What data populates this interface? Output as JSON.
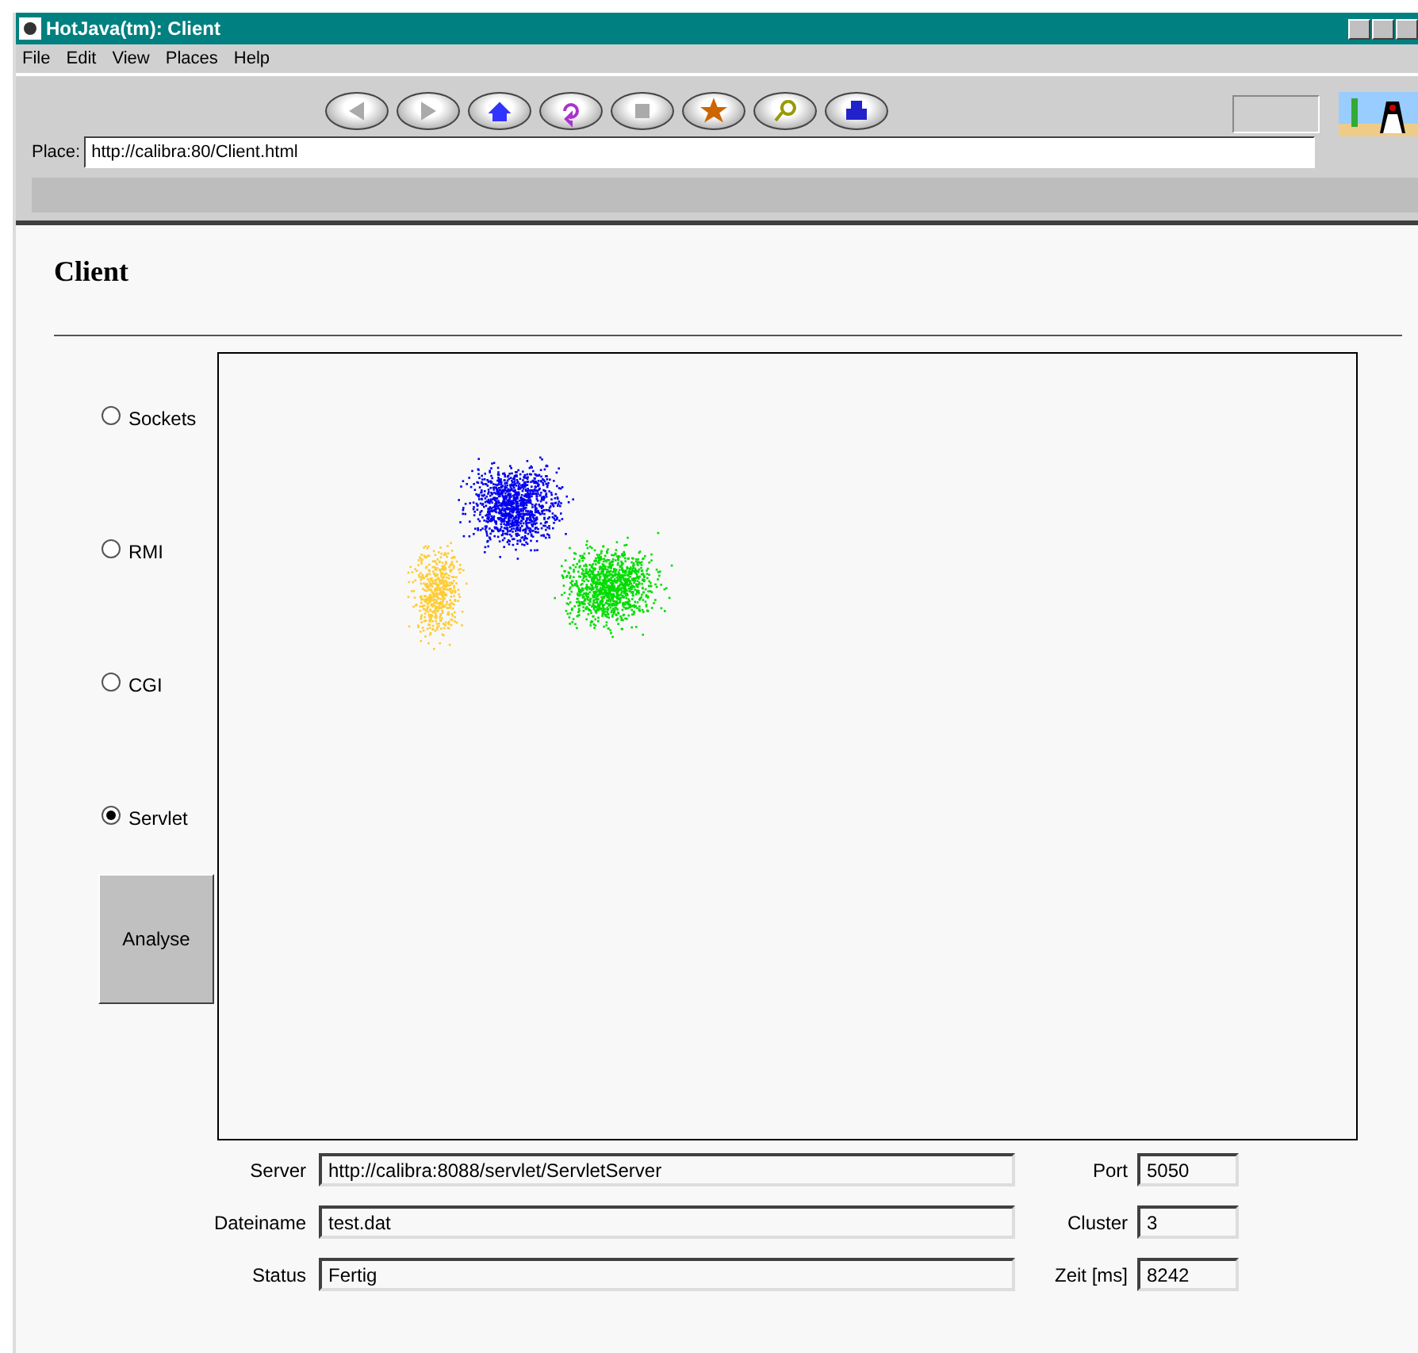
{
  "window": {
    "title": "HotJava(tm): Client"
  },
  "menu": [
    "File",
    "Edit",
    "View",
    "Places",
    "Help"
  ],
  "toolbar": {
    "buttons": [
      {
        "kind": "back",
        "disabled": true
      },
      {
        "kind": "forward",
        "disabled": true
      },
      {
        "kind": "home",
        "disabled": false
      },
      {
        "kind": "reload",
        "disabled": false
      },
      {
        "kind": "stop",
        "disabled": true
      },
      {
        "kind": "star",
        "disabled": false
      },
      {
        "kind": "search",
        "disabled": false
      },
      {
        "kind": "print",
        "disabled": false
      }
    ],
    "place": {
      "label": "Place:",
      "value": "http://calibra:80/Client.html"
    }
  },
  "page": {
    "heading": "Client",
    "options": [
      {
        "label": "Sockets",
        "selected": false
      },
      {
        "label": "RMI",
        "selected": false
      },
      {
        "label": "CGI",
        "selected": false
      },
      {
        "label": "Servlet",
        "selected": true
      }
    ],
    "button": "Analyse",
    "fields": [
      {
        "label": "Server",
        "value": "http://calibra:8088/servlet/ServletServer",
        "side_label": "Port",
        "side_value": "5050"
      },
      {
        "label": "Dateiname",
        "value": "test.dat",
        "side_label": "Cluster",
        "side_value": "3"
      },
      {
        "label": "Status",
        "value": "Fertig",
        "side_label": "Zeit [ms]",
        "side_value": "8242"
      }
    ]
  }
}
